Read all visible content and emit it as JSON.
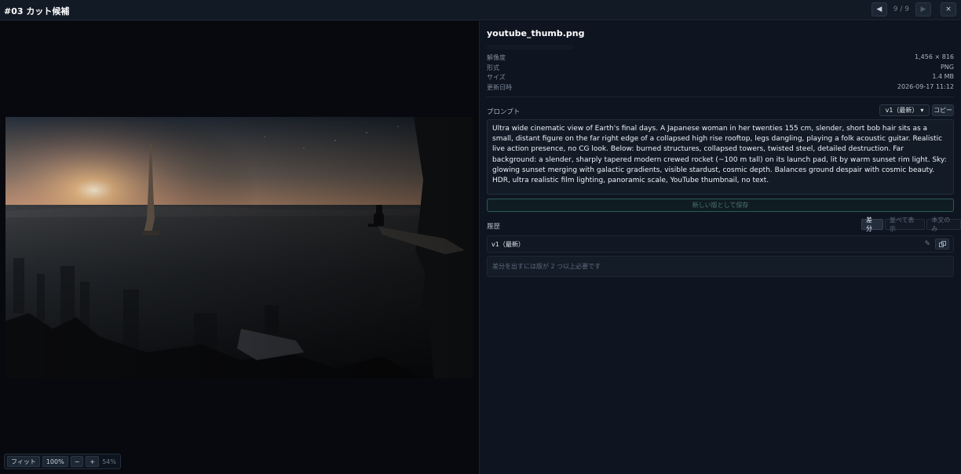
{
  "header": {
    "title": "#03 カット候補",
    "counter": "9 / 9",
    "prev_label": "◀",
    "next_label": "▶",
    "close_label": "×"
  },
  "zoom": {
    "fit_label": "フィット",
    "actual_label": "100%",
    "minus_label": "−",
    "plus_label": "+",
    "percent": "54%"
  },
  "file": {
    "name": "youtube_thumb.png",
    "meta": [
      {
        "label": "解像度",
        "value": "1,456 × 816"
      },
      {
        "label": "形式",
        "value": "PNG"
      },
      {
        "label": "サイズ",
        "value": "1.4 MB"
      },
      {
        "label": "更新日時",
        "value": "2026-09-17 11:12"
      }
    ]
  },
  "prompt": {
    "label": "プロンプト",
    "version_selected": "v1（最新）",
    "copy_label": "コピー",
    "text": "Ultra wide cinematic view of Earth's final days. A Japanese woman in her twenties 155 cm, slender, short bob hair sits as a small, distant figure on the far right edge of a collapsed high rise rooftop, legs dangling, playing a folk acoustic guitar. Realistic live action presence, no CG look. Below: burned structures, collapsed towers, twisted steel, detailed destruction. Far background: a slender, sharply tapered modern crewed rocket (~100 m tall) on its launch pad, lit by warm sunset rim light. Sky: glowing sunset merging with galactic gradients, visible stardust, cosmic depth. Balances ground despair with cosmic beauty. HDR, ultra realistic film lighting, panoramic scale, YouTube thumbnail, no text.",
    "save_label": "新しい版として保存"
  },
  "history": {
    "label": "履歴",
    "tabs": [
      "差分",
      "並べて表示",
      "本文のみ"
    ],
    "active_tab": 0,
    "entry_label": "v1（最新）",
    "notice": "差分を出すには版が 2 つ以上必要です"
  },
  "image": {
    "alt": "youtube_thumb.png"
  },
  "colors": {
    "accent": "#2a5a55",
    "sunset": "#f3c087",
    "background": "#0b1018"
  }
}
